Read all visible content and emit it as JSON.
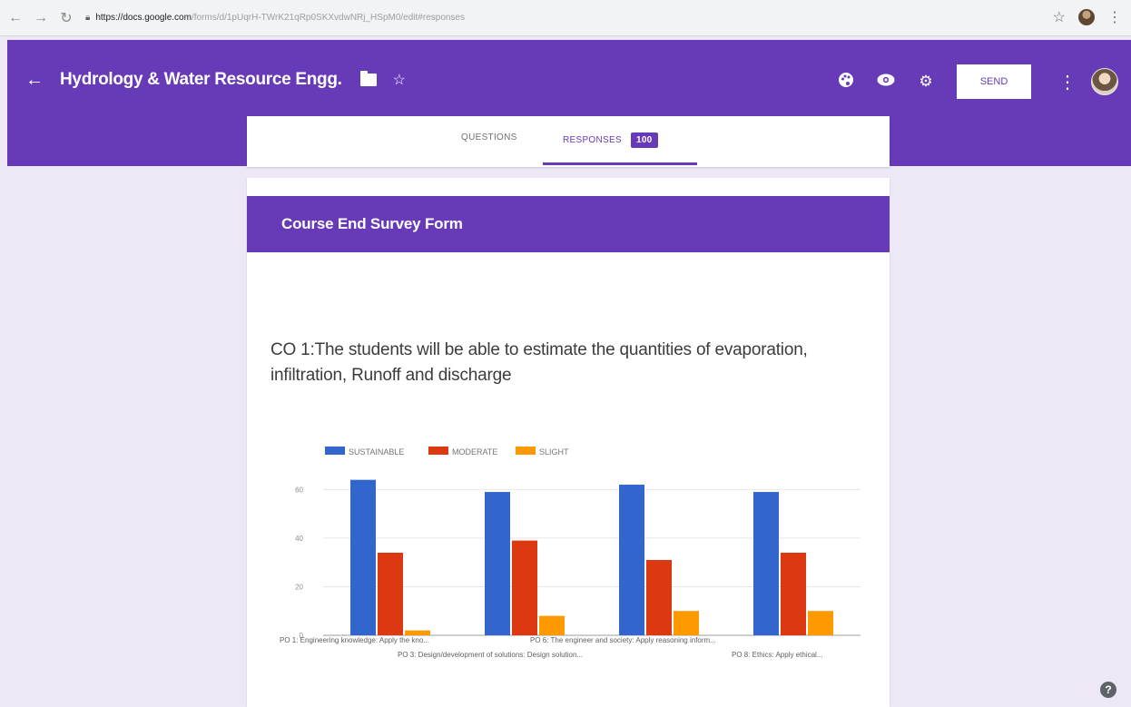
{
  "browser": {
    "url_host": "https://docs.google.com",
    "url_path": "/forms/d/1pUqrH-TWrK21qRp0SKXvdwNRj_HSpM0/edit#responses"
  },
  "header": {
    "title": "Hydrology & Water Resource Engg.",
    "send_label": "SEND"
  },
  "tabs": {
    "questions_label": "QUESTIONS",
    "responses_label": "RESPONSES",
    "responses_count": "100"
  },
  "form": {
    "banner_title": "Course End Survey Form",
    "question_text": "CO 1:The students will be able to estimate the quantities of evaporation, infiltration, Runoff and discharge"
  },
  "chart_data": {
    "type": "bar",
    "categories": [
      "PO 1: Engineering knowledge: Apply the kno...",
      "PO 3: Design/development of solutions: Design solution...",
      "PO 6: The engineer and society: Apply reasoning inform...",
      "PO 8: Ethics: Apply ethical..."
    ],
    "series": [
      {
        "name": "SUSTAINABLE",
        "color": "#3366cc",
        "values": [
          64,
          59,
          62,
          59
        ]
      },
      {
        "name": "MODERATE",
        "color": "#dc3912",
        "values": [
          34,
          39,
          31,
          34
        ]
      },
      {
        "name": "SLIGHT",
        "color": "#ff9900",
        "values": [
          2,
          8,
          10,
          10
        ]
      }
    ],
    "yticks": [
      "0",
      "20",
      "40",
      "60"
    ],
    "ylim": [
      0,
      65
    ],
    "legend_position": "top-left",
    "grid": true
  },
  "icons": {
    "back": "arrow-left-icon",
    "folder": "folder-icon",
    "star": "star-icon",
    "palette": "palette-icon",
    "preview": "eye-icon",
    "settings": "gear-icon",
    "more": "kebab-icon",
    "help": "help-icon"
  },
  "colors": {
    "brand": "#673ab7",
    "page_bg": "#ede7f6"
  }
}
